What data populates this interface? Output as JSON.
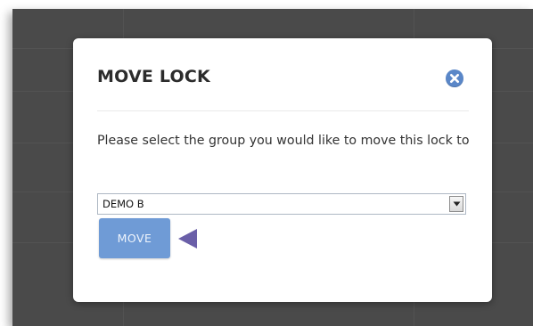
{
  "modal": {
    "title": "MOVE LOCK",
    "prompt": "Please select the group you would like to move this lock to",
    "group_select": {
      "selected_value": "DEMO B"
    },
    "move_label": "MOVE",
    "close_icon": "close-icon"
  },
  "colors": {
    "backdrop": "#4a4a4a",
    "modal_background": "#ffffff",
    "close_button": "#5a87c8",
    "move_button": "#6f9bd6",
    "pointer_arrow": "#6a5fa8"
  }
}
